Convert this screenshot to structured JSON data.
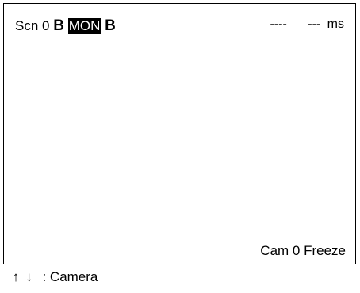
{
  "status": {
    "scene_label": "Scn",
    "scene_number": "0",
    "mode_prefix": "B",
    "mode": "MON",
    "mode_suffix": "B",
    "measure_value": "----",
    "time_value": "---",
    "time_unit": "ms"
  },
  "camera_status": "Cam 0 Freeze",
  "footer": {
    "up_icon": "up-arrow-icon",
    "down_icon": "down-arrow-icon",
    "label": ": Camera"
  }
}
